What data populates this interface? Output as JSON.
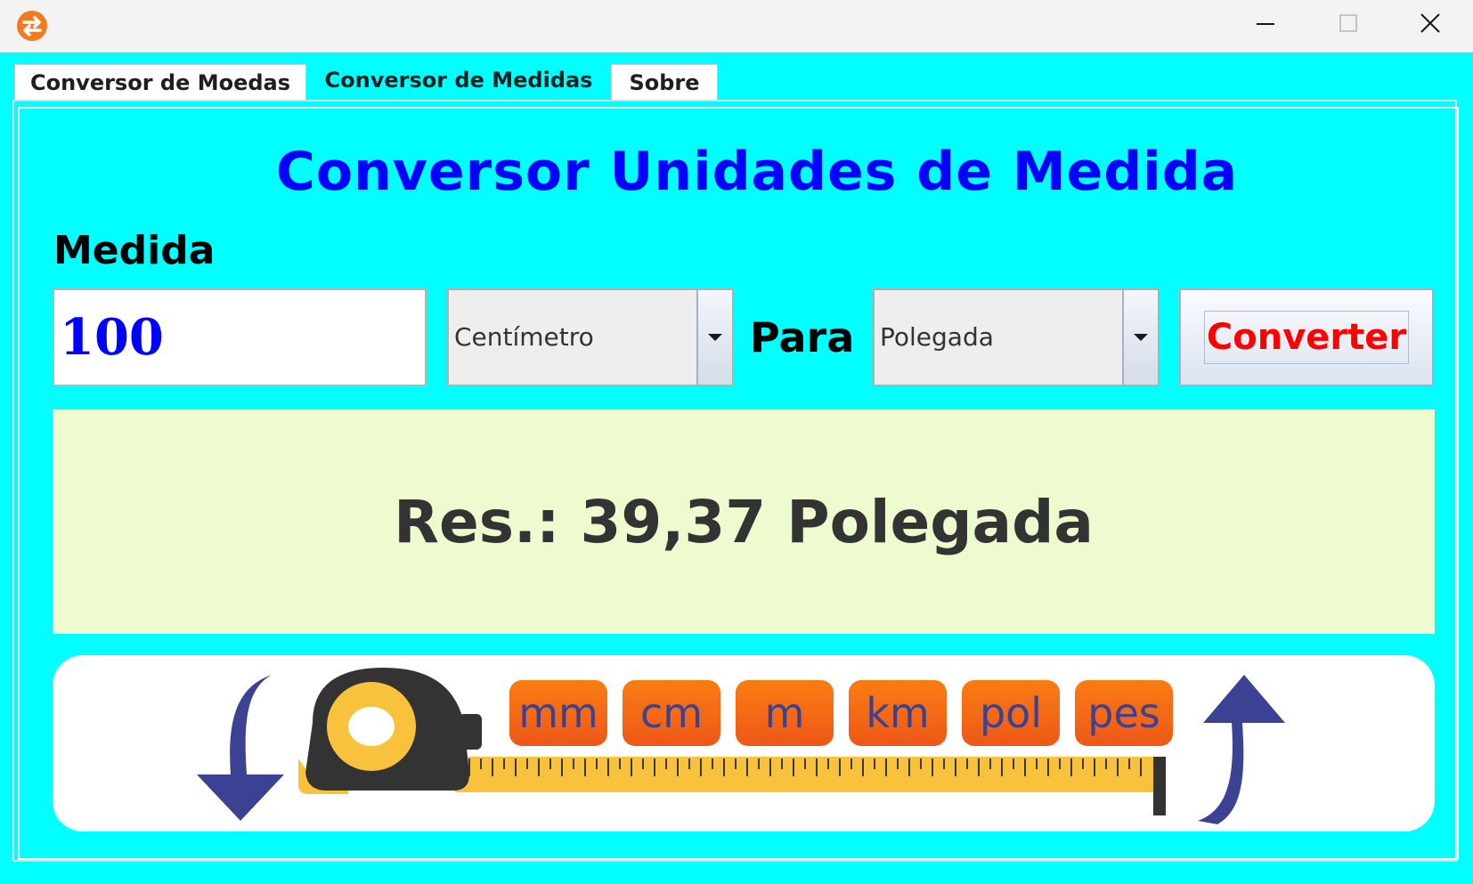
{
  "window": {
    "icon": "currency-exchange-icon",
    "controls": [
      "minimize-icon",
      "maximize-icon",
      "close-icon"
    ]
  },
  "tabs": [
    {
      "label": "Conversor de Moedas",
      "selected": false
    },
    {
      "label": "Conversor de Medidas",
      "selected": true
    },
    {
      "label": "Sobre",
      "selected": false
    }
  ],
  "main": {
    "title": "Conversor Unidades de Medida",
    "measure_label": "Medida",
    "input_value": "100",
    "from_unit": "Centímetro",
    "to_label": "Para",
    "to_unit": "Polegada",
    "convert_label": "Converter",
    "result": "Res.: 39,37 Polegada"
  },
  "banner": {
    "units": [
      "mm",
      "cm",
      "m",
      "km",
      "pol",
      "pes"
    ],
    "icons": [
      "arrow-down-icon",
      "tape-measure-icon",
      "arrow-up-icon"
    ]
  },
  "colors": {
    "background": "#00ffff",
    "title": "#0000ff",
    "convert_text": "#ff0000",
    "result_bg": "#edfbcf",
    "chip": "#f46a15",
    "chip_text": "#3b4294"
  }
}
